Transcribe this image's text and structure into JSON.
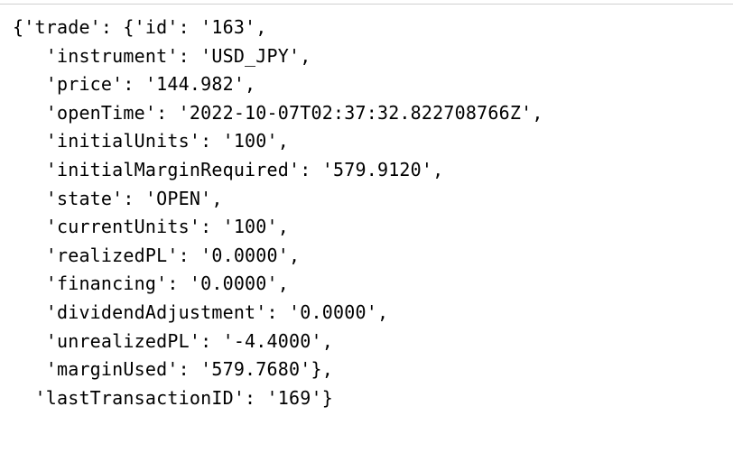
{
  "code": {
    "line1": "{'trade': {'id': '163',",
    "line2": "   'instrument': 'USD_JPY',",
    "line3": "   'price': '144.982',",
    "line4": "   'openTime': '2022-10-07T02:37:32.822708766Z',",
    "line5": "   'initialUnits': '100',",
    "line6": "   'initialMarginRequired': '579.9120',",
    "line7": "   'state': 'OPEN',",
    "line8": "   'currentUnits': '100',",
    "line9": "   'realizedPL': '0.0000',",
    "line10": "   'financing': '0.0000',",
    "line11": "   'dividendAdjustment': '0.0000',",
    "line12": "   'unrealizedPL': '-4.4000',",
    "line13": "   'marginUsed': '579.7680'},",
    "line14": "  'lastTransactionID': '169'}"
  }
}
